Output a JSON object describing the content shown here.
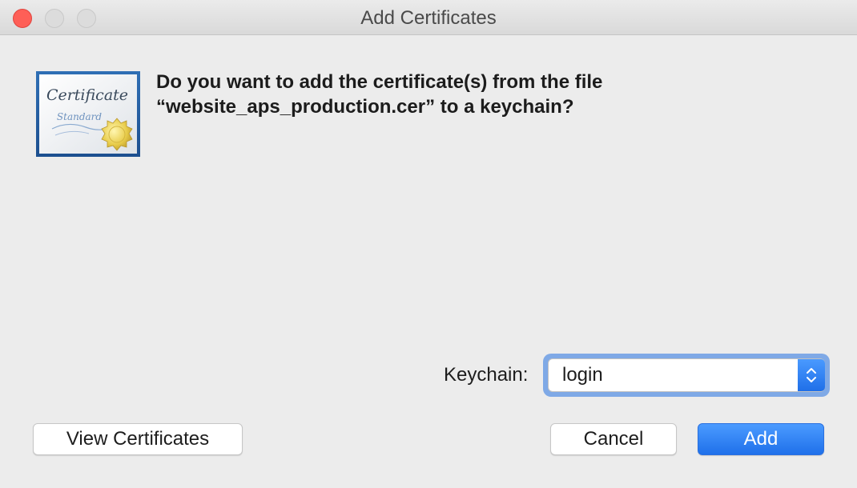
{
  "window": {
    "title": "Add Certificates"
  },
  "icons": {
    "certificate": "certificate-icon",
    "popup_stepper": "chevron-up-down-icon"
  },
  "certificate_icon": {
    "title_text": "Certificate",
    "subtitle_text": "Standard"
  },
  "message": {
    "line1": "Do you want to add the certificate(s) from the file",
    "line2": "“website_aps_production.cer” to a keychain?"
  },
  "keychain": {
    "label": "Keychain:",
    "selected": "login"
  },
  "buttons": {
    "view_certificates": "View Certificates",
    "cancel": "Cancel",
    "add": "Add"
  },
  "colors": {
    "close": "#fe5f57",
    "accent": "#1f70ea",
    "background": "#ececec"
  }
}
